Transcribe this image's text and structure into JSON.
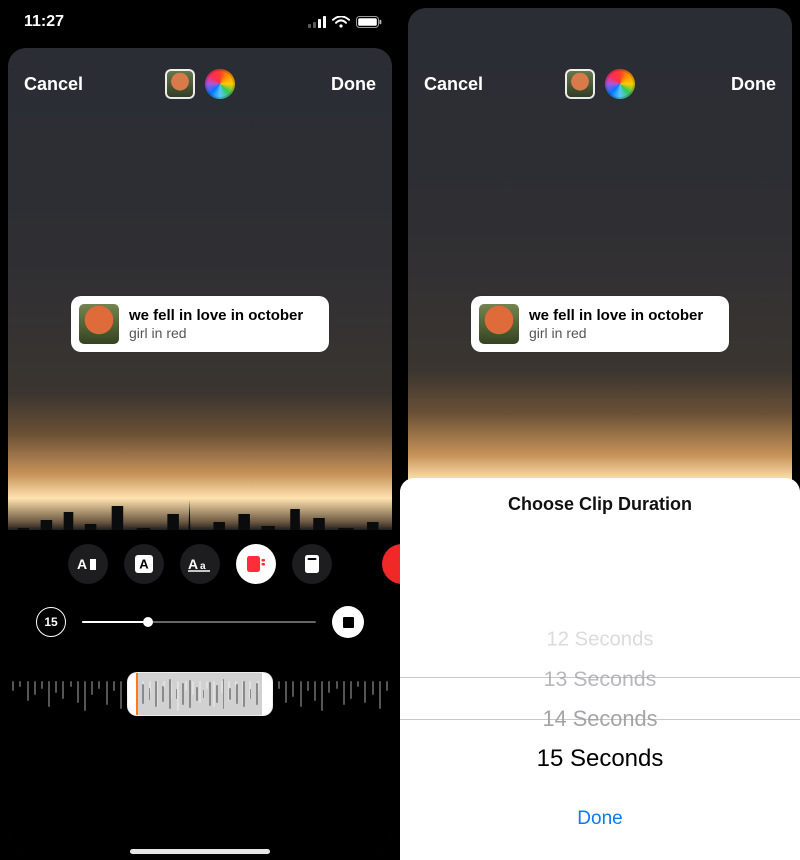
{
  "status": {
    "time": "11:27"
  },
  "actions": {
    "cancel": "Cancel",
    "done": "Done"
  },
  "music": {
    "title": "we fell in love in october",
    "artist": "girl in red"
  },
  "styles": {
    "icons": [
      "dynamic-lyrics",
      "boxed-letter",
      "text-aa",
      "card",
      "sticker"
    ]
  },
  "duration": {
    "current": "15",
    "badge_label": "15",
    "sheet_title": "Choose Clip Duration",
    "options": [
      "12 Seconds",
      "13 Seconds",
      "14 Seconds",
      "15 Seconds"
    ],
    "selected_index": 3,
    "sheet_done": "Done"
  }
}
